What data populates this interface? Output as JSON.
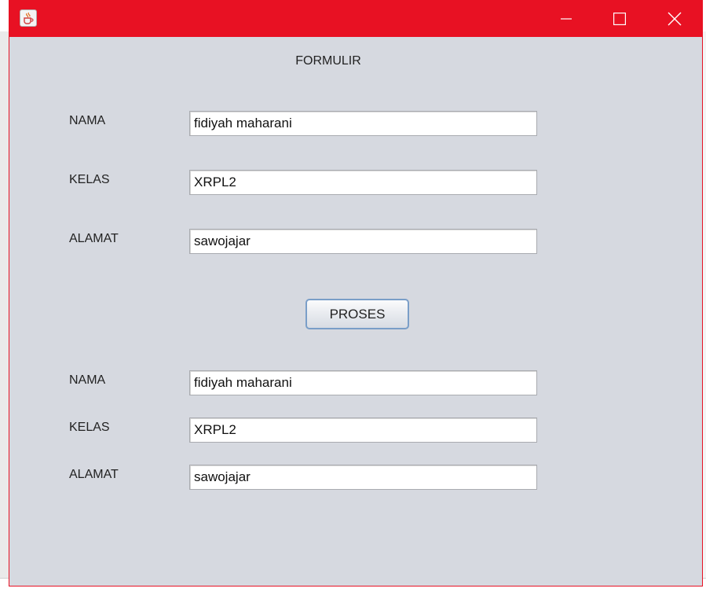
{
  "window": {
    "title": "",
    "controls": {
      "minimize": "minimize",
      "maximize": "maximize",
      "close": "close"
    }
  },
  "form": {
    "title": "FORMULIR",
    "input": {
      "nama_label": "NAMA",
      "nama_value": "fidiyah maharani",
      "kelas_label": "KELAS",
      "kelas_value": "XRPL2",
      "alamat_label": "ALAMAT",
      "alamat_value": "sawojajar"
    },
    "button_label": "PROSES",
    "output": {
      "nama_label": "NAMA",
      "nama_value": "fidiyah maharani",
      "kelas_label": "KELAS",
      "kelas_value": "XRPL2",
      "alamat_label": "ALAMAT",
      "alamat_value": "sawojajar"
    }
  },
  "colors": {
    "titlebar": "#e81123",
    "window_bg": "#d6d9e0"
  },
  "icons": [
    "java-cup-icon",
    "minimize-icon",
    "maximize-icon",
    "close-icon"
  ]
}
